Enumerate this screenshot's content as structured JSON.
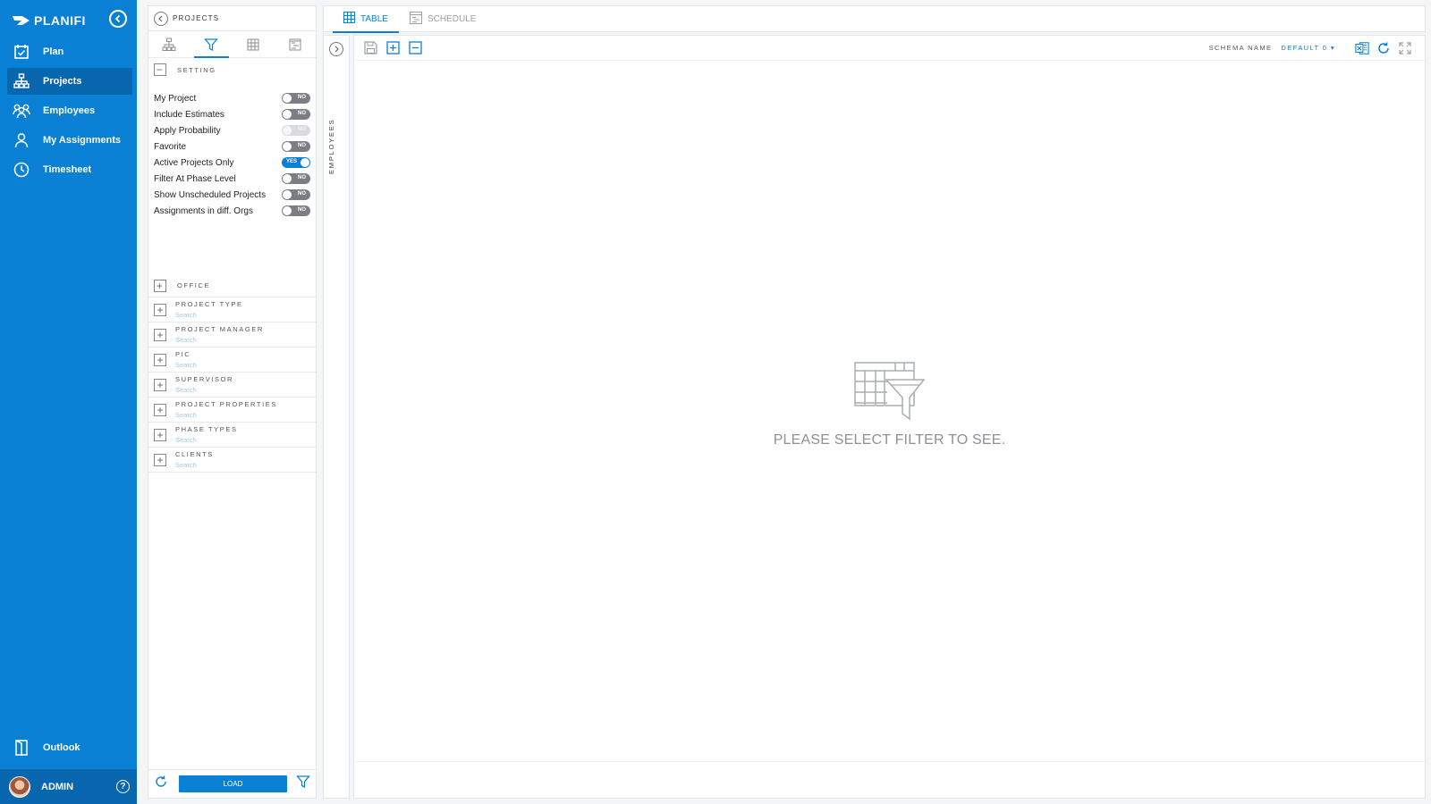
{
  "nav": {
    "brand": "PLANIFI",
    "items": [
      {
        "label": "Plan",
        "icon": "calendar-check-icon"
      },
      {
        "label": "Projects",
        "icon": "org-chart-icon"
      },
      {
        "label": "Employees",
        "icon": "people-icon"
      },
      {
        "label": "My Assignments",
        "icon": "person-icon"
      },
      {
        "label": "Timesheet",
        "icon": "clock-icon"
      }
    ],
    "outlook": "Outlook",
    "user": "ADMIN"
  },
  "filter_panel": {
    "title": "PROJECTS",
    "setting_label": "SETTING",
    "toggles": [
      {
        "label": "My Project",
        "state": "NO"
      },
      {
        "label": "Include Estimates",
        "state": "NO"
      },
      {
        "label": "Apply Probability",
        "state": "NO"
      },
      {
        "label": "Favorite",
        "state": "NO"
      },
      {
        "label": "Active Projects Only",
        "state": "YES"
      },
      {
        "label": "Filter At Phase Level",
        "state": "NO"
      },
      {
        "label": "Show Unscheduled Projects",
        "state": "NO"
      },
      {
        "label": "Assignments in diff. Orgs",
        "state": "NO"
      }
    ],
    "office_label": "OFFICE",
    "groups": [
      {
        "title": "PROJECT TYPE",
        "search": "Search"
      },
      {
        "title": "PROJECT MANAGER",
        "search": "Search"
      },
      {
        "title": "PIC",
        "search": "Search"
      },
      {
        "title": "SUPERVISOR",
        "search": "Search"
      },
      {
        "title": "PROJECT PROPERTIES",
        "search": "Search"
      },
      {
        "title": "PHASE TYPES",
        "search": "Search"
      },
      {
        "title": "CLIENTS",
        "search": "Search"
      }
    ],
    "load_label": "LOAD"
  },
  "rail": {
    "label": "EMPLOYEES"
  },
  "tabs": [
    {
      "label": "TABLE"
    },
    {
      "label": "SCHEDULE"
    }
  ],
  "toolbar": {
    "schema_label": "SCHEMA NAME",
    "schema_value": "DEFAULT 0 ▾"
  },
  "empty": {
    "message": "PLEASE SELECT FILTER TO SEE."
  },
  "colors": {
    "accent": "#0a80d4",
    "nav_bg": "#0a80d4",
    "nav_active": "#0866ae"
  }
}
